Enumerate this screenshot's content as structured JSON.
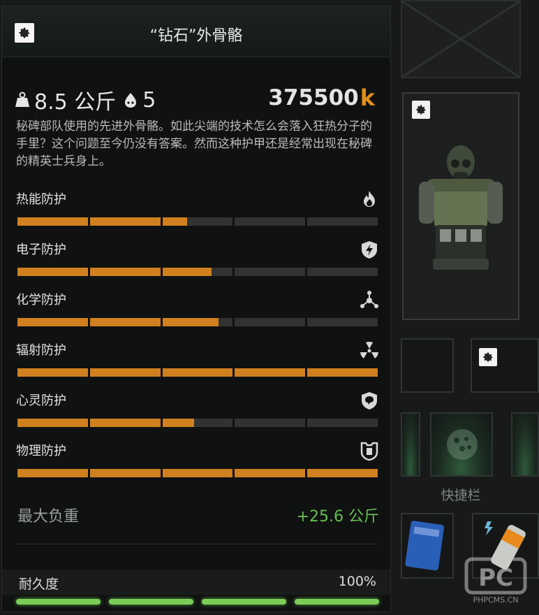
{
  "tooltip": {
    "title": "“钻石”外骨骼",
    "weight": "8.5 公斤",
    "slots": "5",
    "price": "375500",
    "price_currency_symbol": "k",
    "description": "秘碑部队使用的先进外骨骼。如此尖端的技术怎么会落入狂热分子的手里？这个问题至今仍没有答案。然而这种护甲还是经常出现在秘碑的精英士兵身上。",
    "protections": [
      {
        "label": "热能防护",
        "icon": "flame-icon",
        "value": 0.47
      },
      {
        "label": "电子防护",
        "icon": "lightning-shield-icon",
        "value": 0.54
      },
      {
        "label": "化学防护",
        "icon": "chemical-molecule-icon",
        "value": 0.56
      },
      {
        "label": "辐射防护",
        "icon": "radiation-icon",
        "value": 1.0
      },
      {
        "label": "心灵防护",
        "icon": "psy-brain-shield-icon",
        "value": 0.49
      },
      {
        "label": "物理防护",
        "icon": "armor-plate-icon",
        "value": 1.0
      }
    ],
    "max_weight_label": "最大负重",
    "max_weight_value": "+25.6 公斤",
    "durability_label": "耐久度",
    "durability_value": "100%",
    "durability_level": 1.0
  },
  "inventory": {
    "quickbar_label": "快捷栏"
  },
  "colors": {
    "bar_fill": "#d0801e",
    "bar_empty": "#303332",
    "positive": "#66c052",
    "currency": "#e08d1c",
    "durability": "#7ccd58"
  },
  "watermark": {
    "logo": "PC",
    "text": "PHPCMS.CN"
  }
}
